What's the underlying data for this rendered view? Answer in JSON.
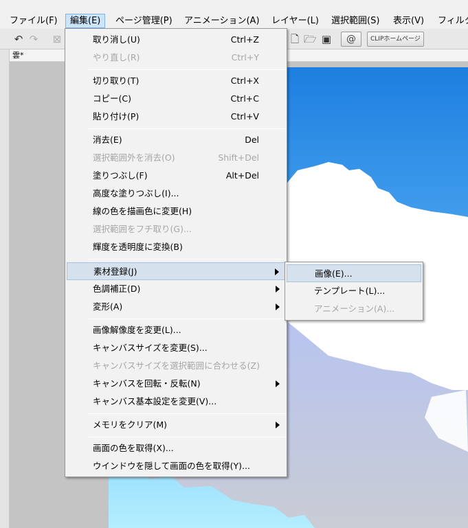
{
  "menubar": {
    "items": [
      {
        "label": "ファイル(F)"
      },
      {
        "label": "編集(E)"
      },
      {
        "label": "ページ管理(P)"
      },
      {
        "label": "アニメーション(A)"
      },
      {
        "label": "レイヤー(L)"
      },
      {
        "label": "選択範囲(S)"
      },
      {
        "label": "表示(V)"
      },
      {
        "label": "フィルタ"
      }
    ]
  },
  "toolbar": {
    "clip_home_label": "CLIPホームページ",
    "icons": [
      "expand-panel-icon",
      "undo-icon",
      "redo-icon",
      "clear-icon",
      "new-file-icon",
      "open-folder-icon",
      "save-icon",
      "clip-swirl-icon"
    ]
  },
  "document": {
    "tab_title": "雲*"
  },
  "edit_menu": {
    "items": [
      {
        "label": "取り消し(U)",
        "shortcut": "Ctrl+Z",
        "enabled": true
      },
      {
        "label": "やり直し(R)",
        "shortcut": "Ctrl+Y",
        "enabled": false
      },
      {
        "label": "切り取り(T)",
        "shortcut": "Ctrl+X",
        "enabled": true
      },
      {
        "label": "コピー(C)",
        "shortcut": "Ctrl+C",
        "enabled": true
      },
      {
        "label": "貼り付け(P)",
        "shortcut": "Ctrl+V",
        "enabled": true
      },
      {
        "label": "消去(E)",
        "shortcut": "Del",
        "enabled": true
      },
      {
        "label": "選択範囲外を消去(O)",
        "shortcut": "Shift+Del",
        "enabled": false
      },
      {
        "label": "塗りつぶし(F)",
        "shortcut": "Alt+Del",
        "enabled": true
      },
      {
        "label": "高度な塗りつぶし(I)...",
        "shortcut": "",
        "enabled": true
      },
      {
        "label": "線の色を描画色に変更(H)",
        "shortcut": "",
        "enabled": true
      },
      {
        "label": "選択範囲をフチ取り(G)...",
        "shortcut": "",
        "enabled": false
      },
      {
        "label": "輝度を透明度に変換(B)",
        "shortcut": "",
        "enabled": true
      },
      {
        "label": "素材登録(J)",
        "shortcut": "",
        "enabled": true,
        "submenu": true,
        "highlighted": true
      },
      {
        "label": "色調補正(D)",
        "shortcut": "",
        "enabled": true,
        "submenu": true
      },
      {
        "label": "変形(A)",
        "shortcut": "",
        "enabled": true,
        "submenu": true
      },
      {
        "label": "画像解像度を変更(L)...",
        "shortcut": "",
        "enabled": true
      },
      {
        "label": "キャンバスサイズを変更(S)...",
        "shortcut": "",
        "enabled": true
      },
      {
        "label": "キャンバスサイズを選択範囲に合わせる(Z)",
        "shortcut": "",
        "enabled": false
      },
      {
        "label": "キャンバスを回転・反転(N)",
        "shortcut": "",
        "enabled": true,
        "submenu": true
      },
      {
        "label": "キャンバス基本設定を変更(V)...",
        "shortcut": "",
        "enabled": true
      },
      {
        "label": "メモリをクリア(M)",
        "shortcut": "",
        "enabled": true,
        "submenu": true
      },
      {
        "label": "画面の色を取得(X)...",
        "shortcut": "",
        "enabled": true
      },
      {
        "label": "ウインドウを隠して画面の色を取得(Y)...",
        "shortcut": "",
        "enabled": true
      }
    ]
  },
  "material_submenu": {
    "items": [
      {
        "label": "画像(E)...",
        "enabled": true,
        "highlighted": true
      },
      {
        "label": "テンプレート(L)...",
        "enabled": true
      },
      {
        "label": "アニメーション(A)...",
        "enabled": false
      }
    ]
  },
  "colors": {
    "sky_top": "#1e7fe0",
    "sky_bottom": "#b0ecff",
    "cloud_white": "#ffffff",
    "cloud_shadow": "#c4c9d6",
    "menu_highlight": "#d5e1ec"
  }
}
